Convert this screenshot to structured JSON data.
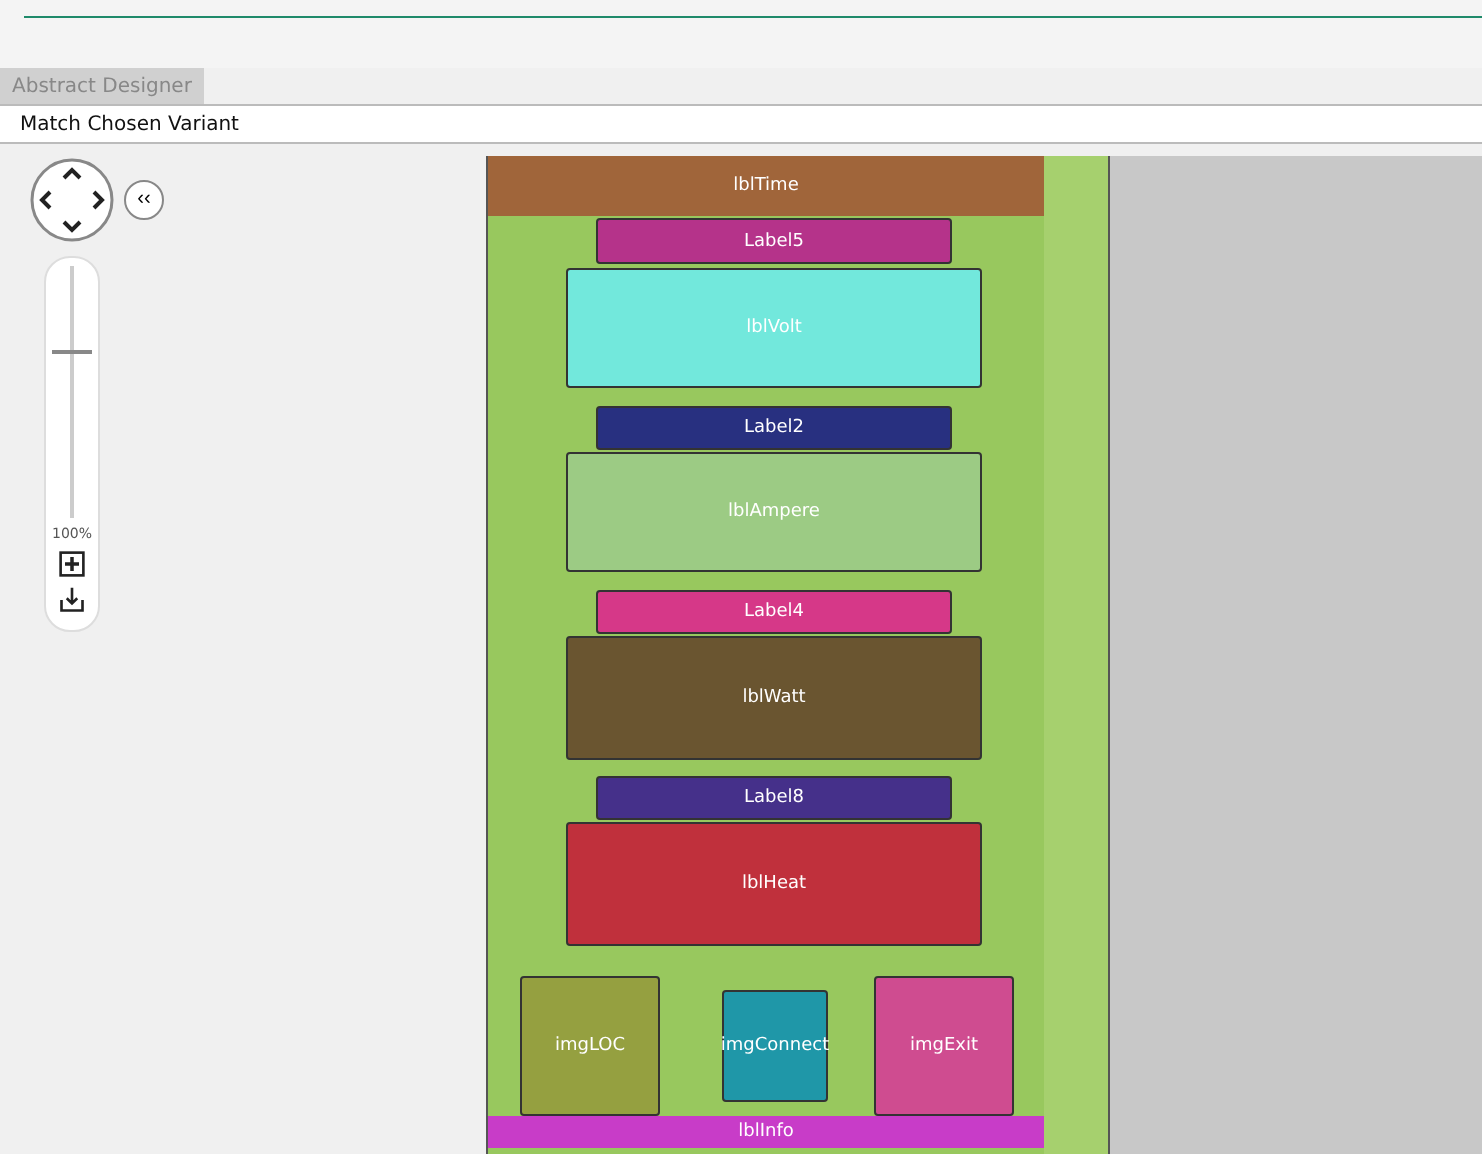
{
  "tabs": [
    {
      "label": "Abstract Designer",
      "selected": true
    }
  ],
  "toolbar": {
    "variant_label": "Match Chosen Variant"
  },
  "navigator": {
    "collapse_symbol": "‹‹",
    "zoom": {
      "level": 0.65,
      "reading": "100%"
    }
  },
  "canvas": {
    "controls": [
      {
        "label": "lblTime",
        "color": "#a0653a",
        "kind": "bar"
      },
      {
        "label": "Label5",
        "color": "#b5338a",
        "kind": "label"
      },
      {
        "label": "lblVolt",
        "color": "#72e8dc",
        "kind": "value"
      },
      {
        "label": "Label2",
        "color": "#283080",
        "kind": "label"
      },
      {
        "label": "lblAmpere",
        "color": "#9ccb84",
        "kind": "value"
      },
      {
        "label": "Label4",
        "color": "#d63888",
        "kind": "label"
      },
      {
        "label": "lblWatt",
        "color": "#6a5530",
        "kind": "value"
      },
      {
        "label": "Label8",
        "color": "#45308a",
        "kind": "label"
      },
      {
        "label": "lblHeat",
        "color": "#c0303c",
        "kind": "value"
      },
      {
        "label": "imgLOC",
        "color": "#95a040",
        "kind": "image"
      },
      {
        "label": "imgConnect",
        "color": "#1f97a8",
        "kind": "image"
      },
      {
        "label": "imgExit",
        "color": "#cf4c90",
        "kind": "image"
      },
      {
        "label": "lblInfo",
        "color": "#c83cc8",
        "kind": "bar"
      }
    ]
  }
}
